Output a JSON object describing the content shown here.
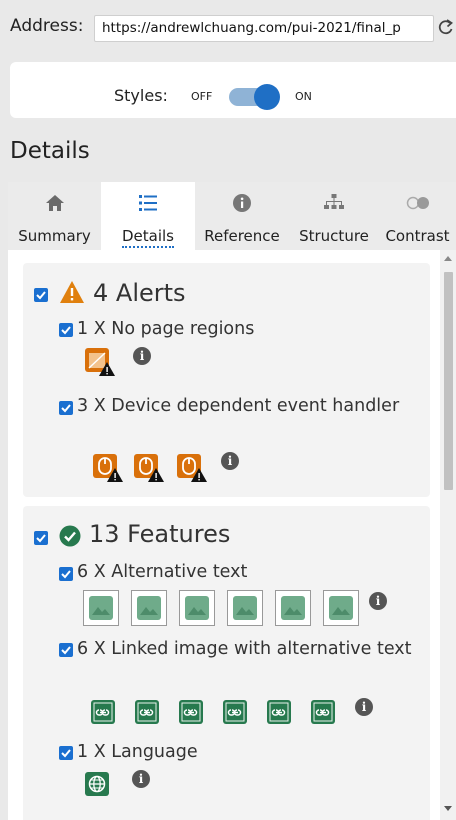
{
  "address": {
    "label": "Address:",
    "url": "https://andrewlchuang.com/pui-2021/final_p"
  },
  "styles": {
    "label": "Styles:",
    "off_label": "OFF",
    "on_label": "ON",
    "enabled": true
  },
  "heading": "Details",
  "tabs": [
    {
      "label": "Summary",
      "icon": "home-icon",
      "active": false
    },
    {
      "label": "Details",
      "icon": "list-icon",
      "active": true
    },
    {
      "label": "Reference",
      "icon": "info-icon",
      "active": false
    },
    {
      "label": "Structure",
      "icon": "sitemap-icon",
      "active": false
    },
    {
      "label": "Contrast",
      "icon": "contrast-icon",
      "active": false
    }
  ],
  "alerts": {
    "title": "4 Alerts",
    "icon": "warning-icon",
    "items": [
      {
        "label": "1 X No page regions",
        "icon": "no-regions-icon",
        "count": 1
      },
      {
        "label": "3 X Device dependent event handler",
        "icon": "mouse-event-icon",
        "count": 3
      }
    ]
  },
  "features": {
    "title": "13 Features",
    "icon": "check-circle-icon",
    "items": [
      {
        "label": "6 X Alternative text",
        "icon": "image-icon",
        "count": 6
      },
      {
        "label": "6 X Linked image with alternative text",
        "icon": "linked-image-icon",
        "count": 6
      },
      {
        "label": "1 X Language",
        "icon": "globe-icon",
        "count": 1
      }
    ]
  },
  "colors": {
    "accent": "#1f6fc5",
    "alert": "#d9700a",
    "feature": "#27794e",
    "feature_light": "#6fab8a"
  }
}
